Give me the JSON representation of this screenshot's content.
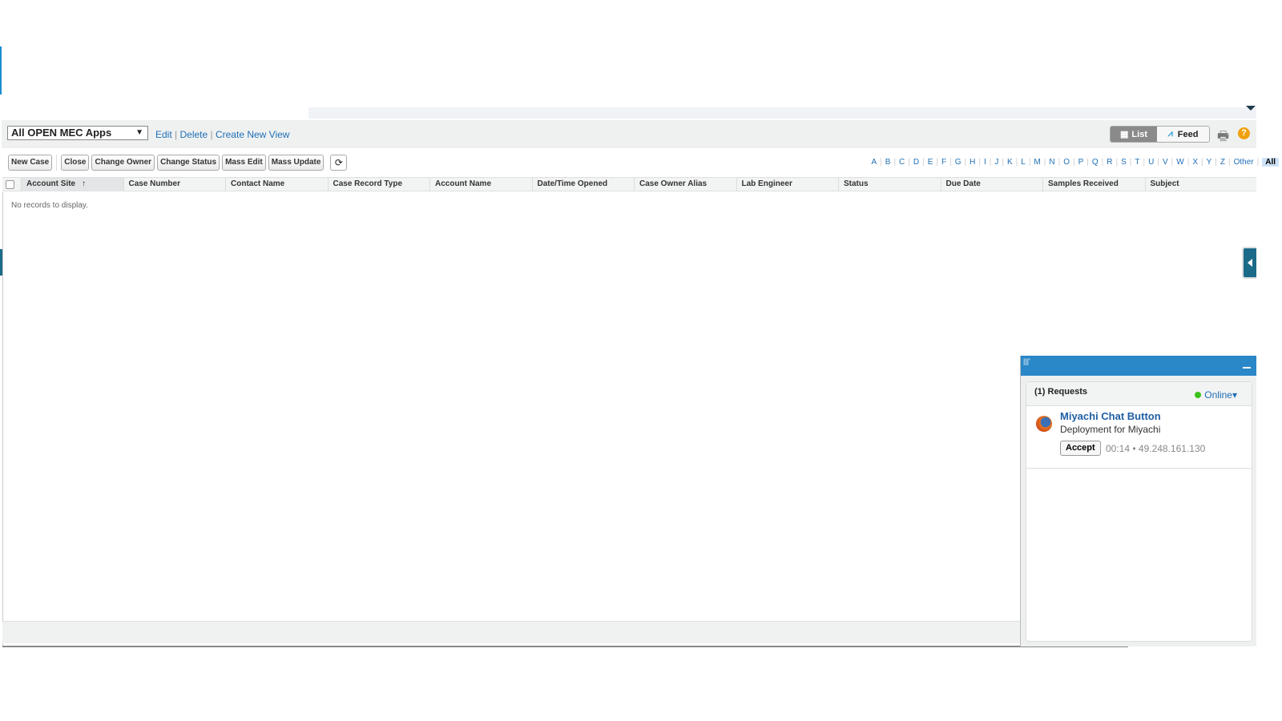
{
  "view": {
    "selected": "All OPEN MEC Apps",
    "edit": "Edit",
    "delete": "Delete",
    "create": "Create New View",
    "list": "List",
    "feed": "Feed"
  },
  "buttons": [
    "New Case",
    "Close",
    "Change Owner",
    "Change Status",
    "Mass Edit",
    "Mass Update"
  ],
  "alpha": [
    "A",
    "B",
    "C",
    "D",
    "E",
    "F",
    "G",
    "H",
    "I",
    "J",
    "K",
    "L",
    "M",
    "N",
    "O",
    "P",
    "Q",
    "R",
    "S",
    "T",
    "U",
    "V",
    "W",
    "X",
    "Y",
    "Z",
    "Other"
  ],
  "alpha_all": "All",
  "columns": [
    "Account Site",
    "Case Number",
    "Contact Name",
    "Case Record Type",
    "Account Name",
    "Date/Time Opened",
    "Case Owner Alias",
    "Lab Engineer",
    "Status",
    "Due Date",
    "Samples Received",
    "Subject"
  ],
  "sort_indicator": "↑",
  "empty": "No records to display.",
  "chat": {
    "requests": "(1) Requests",
    "status": "Online",
    "name": "Miyachi Chat Button",
    "deployment": "Deployment for Miyachi",
    "accept": "Accept",
    "meta": "00:14 • 49.248.161.130"
  }
}
